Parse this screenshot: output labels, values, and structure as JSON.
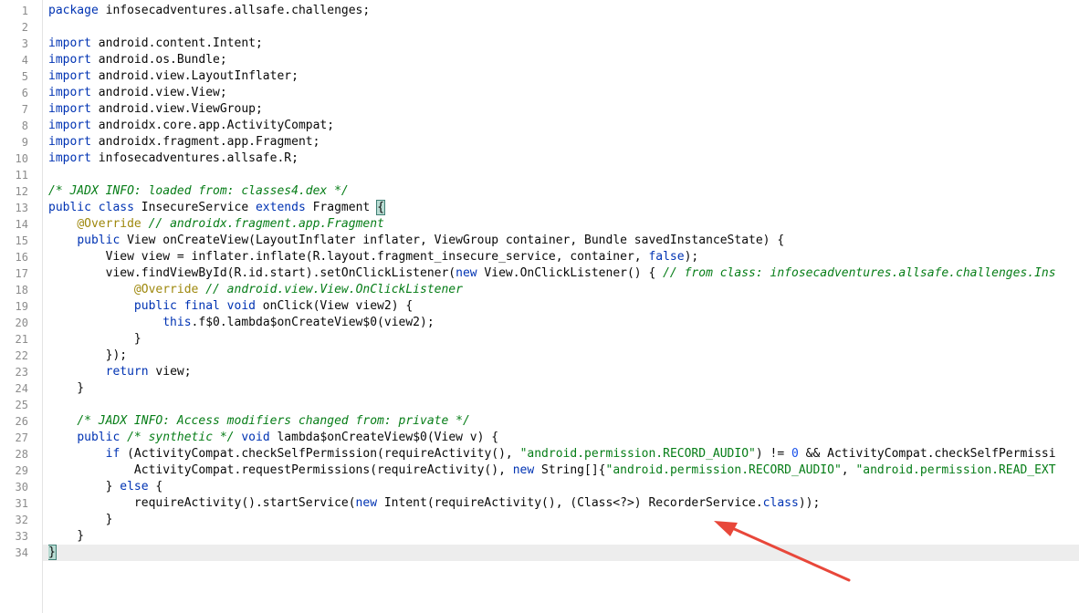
{
  "colors": {
    "background": "#ffffff",
    "gutter_text": "#8c8c8c",
    "caret_line": "#ededed",
    "keyword": "#0033b3",
    "comment": "#067d17",
    "annotation": "#9e880d",
    "string": "#067d17",
    "number": "#1750eb",
    "arrow": "#e8473a"
  },
  "editor": {
    "caret_line": 34,
    "lines": [
      [
        [
          "kw",
          "package"
        ],
        [
          "tx",
          " infosecadventures.allsafe.challenges;"
        ]
      ],
      [],
      [
        [
          "kw",
          "import"
        ],
        [
          "tx",
          " android.content.Intent;"
        ]
      ],
      [
        [
          "kw",
          "import"
        ],
        [
          "tx",
          " android.os.Bundle;"
        ]
      ],
      [
        [
          "kw",
          "import"
        ],
        [
          "tx",
          " android.view.LayoutInflater;"
        ]
      ],
      [
        [
          "kw",
          "import"
        ],
        [
          "tx",
          " android.view.View;"
        ]
      ],
      [
        [
          "kw",
          "import"
        ],
        [
          "tx",
          " android.view.ViewGroup;"
        ]
      ],
      [
        [
          "kw",
          "import"
        ],
        [
          "tx",
          " androidx.core.app.ActivityCompat;"
        ]
      ],
      [
        [
          "kw",
          "import"
        ],
        [
          "tx",
          " androidx.fragment.app.Fragment;"
        ]
      ],
      [
        [
          "kw",
          "import"
        ],
        [
          "tx",
          " infosecadventures.allsafe.R;"
        ]
      ],
      [],
      [
        [
          "cm",
          "/* JADX INFO: loaded from: classes4.dex */"
        ]
      ],
      [
        [
          "kw",
          "public class"
        ],
        [
          "tx",
          " InsecureService "
        ],
        [
          "kw",
          "extends"
        ],
        [
          "tx",
          " Fragment "
        ],
        [
          "br",
          "{"
        ]
      ],
      [
        [
          "tx",
          "    "
        ],
        [
          "an",
          "@Override"
        ],
        [
          "tx",
          " "
        ],
        [
          "cm",
          "// androidx.fragment.app.Fragment"
        ]
      ],
      [
        [
          "tx",
          "    "
        ],
        [
          "kw",
          "public"
        ],
        [
          "tx",
          " View onCreateView(LayoutInflater inflater, ViewGroup container, Bundle savedInstanceState) {"
        ]
      ],
      [
        [
          "tx",
          "        View view = inflater.inflate(R.layout.fragment_insecure_service, container, "
        ],
        [
          "kw",
          "false"
        ],
        [
          "tx",
          ");"
        ]
      ],
      [
        [
          "tx",
          "        view.findViewById(R.id.start).setOnClickListener("
        ],
        [
          "kw",
          "new"
        ],
        [
          "tx",
          " View.OnClickListener() { "
        ],
        [
          "cm",
          "// from class: infosecadventures.allsafe.challenges.Ins"
        ]
      ],
      [
        [
          "tx",
          "            "
        ],
        [
          "an",
          "@Override"
        ],
        [
          "tx",
          " "
        ],
        [
          "cm",
          "// android.view.View.OnClickListener"
        ]
      ],
      [
        [
          "tx",
          "            "
        ],
        [
          "kw",
          "public final void"
        ],
        [
          "tx",
          " onClick(View view2) {"
        ]
      ],
      [
        [
          "tx",
          "                "
        ],
        [
          "kw",
          "this"
        ],
        [
          "tx",
          ".f$0.lambda$onCreateView$0(view2);"
        ]
      ],
      [
        [
          "tx",
          "            }"
        ]
      ],
      [
        [
          "tx",
          "        });"
        ]
      ],
      [
        [
          "tx",
          "        "
        ],
        [
          "kw",
          "return"
        ],
        [
          "tx",
          " view;"
        ]
      ],
      [
        [
          "tx",
          "    }"
        ]
      ],
      [],
      [
        [
          "tx",
          "    "
        ],
        [
          "cm",
          "/* JADX INFO: Access modifiers changed from: private */"
        ]
      ],
      [
        [
          "tx",
          "    "
        ],
        [
          "kw",
          "public"
        ],
        [
          "tx",
          " "
        ],
        [
          "cm",
          "/* synthetic */"
        ],
        [
          "tx",
          " "
        ],
        [
          "kw",
          "void"
        ],
        [
          "tx",
          " lambda$onCreateView$0(View v) {"
        ]
      ],
      [
        [
          "tx",
          "        "
        ],
        [
          "kw",
          "if"
        ],
        [
          "tx",
          " (ActivityCompat.checkSelfPermission(requireActivity(), "
        ],
        [
          "st",
          "\"android.permission.RECORD_AUDIO\""
        ],
        [
          "tx",
          ") != "
        ],
        [
          "nm",
          "0"
        ],
        [
          "tx",
          " && ActivityCompat.checkSelfPermissi"
        ]
      ],
      [
        [
          "tx",
          "            ActivityCompat.requestPermissions(requireActivity(), "
        ],
        [
          "kw",
          "new"
        ],
        [
          "tx",
          " String[]{"
        ],
        [
          "st",
          "\"android.permission.RECORD_AUDIO\""
        ],
        [
          "tx",
          ", "
        ],
        [
          "st",
          "\"android.permission.READ_EXT"
        ]
      ],
      [
        [
          "tx",
          "        } "
        ],
        [
          "kw",
          "else"
        ],
        [
          "tx",
          " {"
        ]
      ],
      [
        [
          "tx",
          "            requireActivity().startService("
        ],
        [
          "kw",
          "new"
        ],
        [
          "tx",
          " Intent(requireActivity(), (Class<?>) RecorderService."
        ],
        [
          "kw",
          "class"
        ],
        [
          "tx",
          "));"
        ]
      ],
      [
        [
          "tx",
          "        }"
        ]
      ],
      [
        [
          "tx",
          "    }"
        ]
      ],
      [
        [
          "br",
          "}"
        ]
      ]
    ]
  }
}
